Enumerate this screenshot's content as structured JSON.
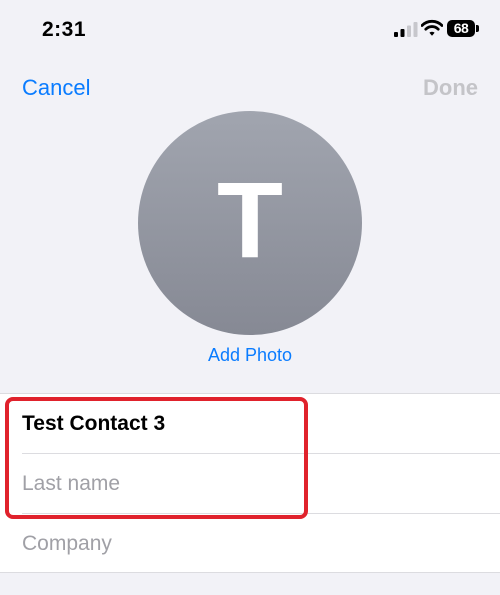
{
  "status_bar": {
    "time": "2:31",
    "battery_level": "68",
    "signal_icon": "cellular-signal-icon",
    "wifi_icon": "wifi-icon",
    "battery_icon": "battery-icon"
  },
  "nav": {
    "cancel_label": "Cancel",
    "done_label": "Done"
  },
  "avatar": {
    "initial": "T",
    "add_photo_label": "Add Photo"
  },
  "form": {
    "first_name_value": "Test Contact 3",
    "last_name_placeholder": "Last name",
    "company_placeholder": "Company"
  },
  "colors": {
    "accent": "#0a7cff",
    "highlight": "#e0222c",
    "background": "#f2f2f7",
    "disabled": "#c4c4c8"
  }
}
